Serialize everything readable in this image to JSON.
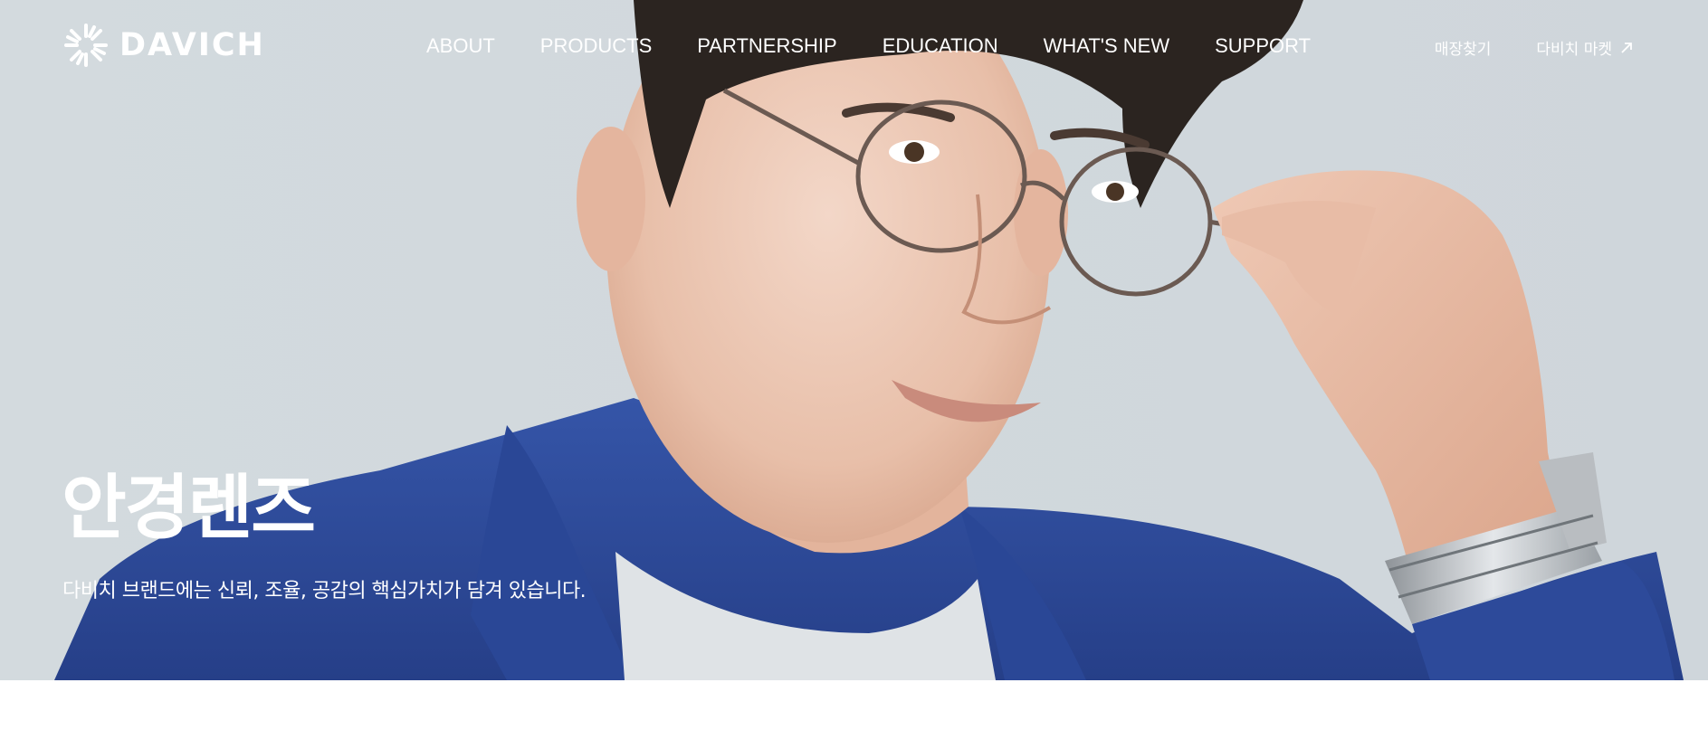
{
  "brand": {
    "logo_text": "DAVICH",
    "logo_icon": "sunburst-logo-icon"
  },
  "nav": {
    "items": [
      {
        "label": "ABOUT"
      },
      {
        "label": "PRODUCTS"
      },
      {
        "label": "PARTNERSHIP"
      },
      {
        "label": "EDUCATION"
      },
      {
        "label": "WHAT'S NEW"
      },
      {
        "label": "SUPPORT"
      }
    ]
  },
  "utility": {
    "store_finder": "매장찾기",
    "market_link": "다비치 마켓",
    "market_icon": "external-arrow-icon"
  },
  "hero": {
    "title": "안경렌즈",
    "subtitle": "다비치 브랜드에는 신뢰, 조율, 공감의 핵심가치가 담겨 있습니다.",
    "image": "model-wearing-round-glasses-photo"
  },
  "colors": {
    "hero_background": "#d0d8dd",
    "header_text": "#ffffff",
    "jacket_blue": "#2d4a9a"
  }
}
